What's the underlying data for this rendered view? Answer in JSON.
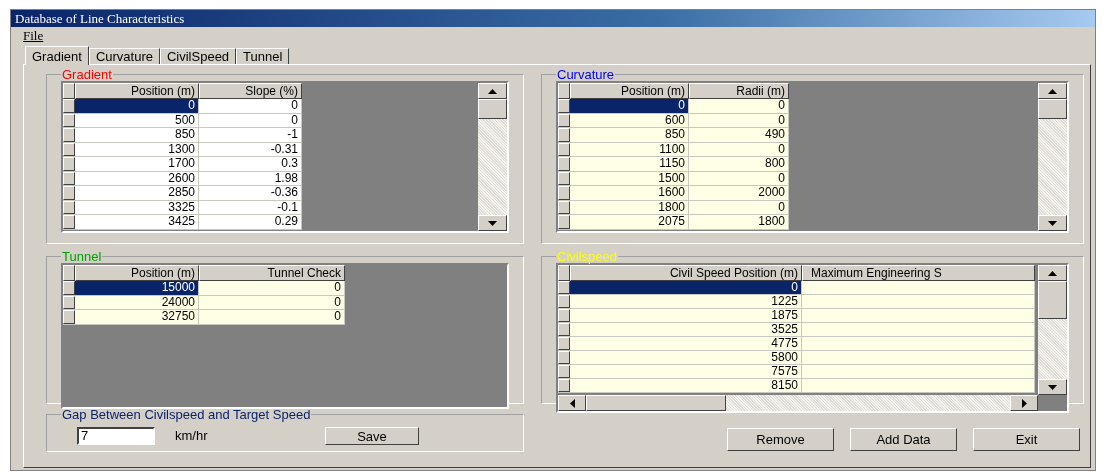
{
  "window": {
    "title": "Database of Line Characteristics"
  },
  "menu": [
    {
      "label": "File"
    }
  ],
  "tabs": [
    {
      "label": "Gradient",
      "selected": true
    },
    {
      "label": "Curvature",
      "selected": false
    },
    {
      "label": "CivilSpeed",
      "selected": false
    },
    {
      "label": "Tunnel",
      "selected": false
    }
  ],
  "panels": [
    {
      "title": "Gradient",
      "color": "#ff0000",
      "columns": [
        "Position (m)",
        "Slope (%)"
      ],
      "rows": [
        {
          "cells": [
            "0",
            "0"
          ],
          "selected": true
        },
        {
          "cells": [
            "500",
            "0"
          ],
          "selected": false
        },
        {
          "cells": [
            "850",
            "-1"
          ],
          "selected": false
        },
        {
          "cells": [
            "1300",
            "-0.31"
          ],
          "selected": false
        },
        {
          "cells": [
            "1700",
            "0.3"
          ],
          "selected": false
        },
        {
          "cells": [
            "2600",
            "1.98"
          ],
          "selected": false
        },
        {
          "cells": [
            "2850",
            "-0.36"
          ],
          "selected": false
        },
        {
          "cells": [
            "3325",
            "-0.1"
          ],
          "selected": false
        },
        {
          "cells": [
            "3425",
            "0.29"
          ],
          "selected": false
        }
      ]
    },
    {
      "title": "Curvature",
      "color": "#0000ff",
      "columns": [
        "Position (m)",
        "Radii (m)"
      ],
      "rows": [
        {
          "cells": [
            "0",
            "0"
          ],
          "selected": true
        },
        {
          "cells": [
            "600",
            "0"
          ],
          "selected": false
        },
        {
          "cells": [
            "850",
            "490"
          ],
          "selected": false
        },
        {
          "cells": [
            "1100",
            "0"
          ],
          "selected": false
        },
        {
          "cells": [
            "1150",
            "800"
          ],
          "selected": false
        },
        {
          "cells": [
            "1500",
            "0"
          ],
          "selected": false
        },
        {
          "cells": [
            "1600",
            "2000"
          ],
          "selected": false
        },
        {
          "cells": [
            "1800",
            "0"
          ],
          "selected": false
        },
        {
          "cells": [
            "2075",
            "1800"
          ],
          "selected": false
        }
      ]
    },
    {
      "title": "Tunnel",
      "color": "#00a000",
      "columns": [
        "Position (m)",
        "Tunnel Check"
      ],
      "rows": [
        {
          "cells": [
            "15000",
            "0"
          ],
          "selected": true
        },
        {
          "cells": [
            "24000",
            "0"
          ],
          "selected": false
        },
        {
          "cells": [
            "32750",
            "0"
          ],
          "selected": false
        }
      ]
    },
    {
      "title": "Civilspeed",
      "color": "#ffff00",
      "columns": [
        "Civil Speed Position (m)",
        "Maximum Engineering S"
      ],
      "rows": [
        {
          "cells": [
            "0"
          ],
          "selected": true
        },
        {
          "cells": [
            "1225"
          ],
          "selected": false
        },
        {
          "cells": [
            "1875"
          ],
          "selected": false
        },
        {
          "cells": [
            "3525"
          ],
          "selected": false
        },
        {
          "cells": [
            "4775"
          ],
          "selected": false
        },
        {
          "cells": [
            "5800"
          ],
          "selected": false
        },
        {
          "cells": [
            "7575"
          ],
          "selected": false
        },
        {
          "cells": [
            "8150"
          ],
          "selected": false
        }
      ]
    }
  ],
  "gap": {
    "title": "Gap Between Civilspeed and Target Speed",
    "value": "7",
    "unit": "km/hr",
    "button": "Save"
  },
  "buttons": [
    "Remove",
    "Add Data",
    "Exit"
  ]
}
